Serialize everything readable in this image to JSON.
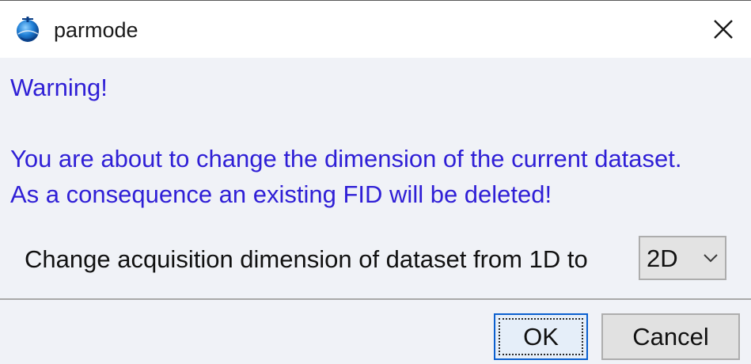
{
  "window": {
    "title": "parmode",
    "icon": "bruker-app-icon",
    "close_icon": "close-icon"
  },
  "message": {
    "heading": "Warning!",
    "line1": "You are about to change the dimension of the current dataset.",
    "line2": "As a consequence an existing FID will be deleted!"
  },
  "dimension": {
    "label": "Change acquisition dimension of dataset from 1D to",
    "selected": "2D",
    "chevron_icon": "chevron-down-icon"
  },
  "buttons": {
    "ok": "OK",
    "cancel": "Cancel"
  },
  "colors": {
    "warning_text": "#2f1fd6",
    "background": "#f0f2f7",
    "ok_border": "#0a5fcf"
  }
}
